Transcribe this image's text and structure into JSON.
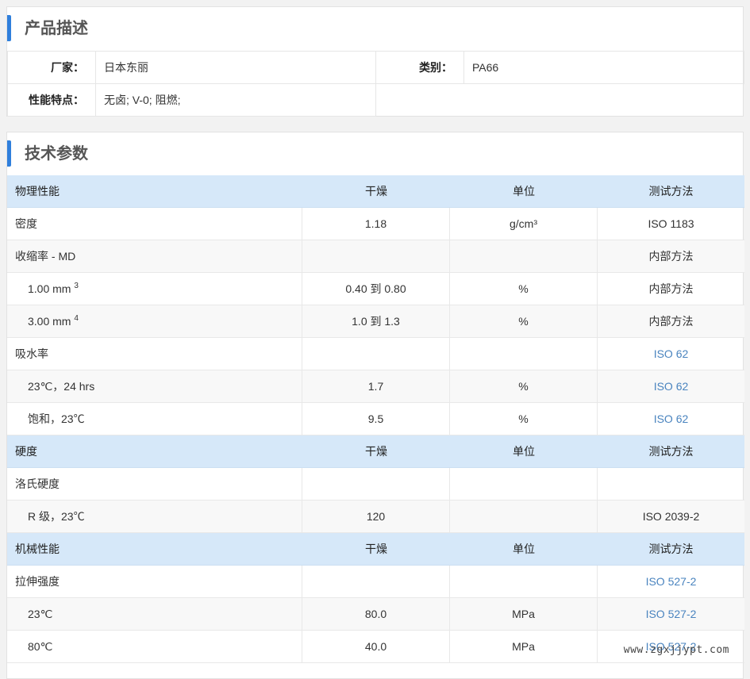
{
  "product": {
    "title": "产品描述",
    "manufacturer_label": "厂家：",
    "manufacturer_value": "日本东丽",
    "category_label": "类别：",
    "category_value": "PA66",
    "features_label": "性能特点：",
    "features_value": "无卤; V-0; 阻燃;"
  },
  "tech": {
    "title": "技术参数",
    "rows": [
      {
        "type": "header",
        "c1": "物理性能",
        "c2": "干燥",
        "c3": "单位",
        "c4": "测试方法"
      },
      {
        "type": "data",
        "c1": "密度",
        "c2": "1.18",
        "c3": "g/cm³",
        "c4": "ISO 1183"
      },
      {
        "type": "data",
        "c1": "收缩率 - MD",
        "c2": "",
        "c3": "",
        "c4": "内部方法"
      },
      {
        "type": "sub",
        "c1": "1.00 mm",
        "sup": "3",
        "c2": "0.40 到 0.80",
        "c3": "%",
        "c4": "内部方法"
      },
      {
        "type": "sub",
        "c1": "3.00 mm",
        "sup": "4",
        "c2": "1.0 到 1.3",
        "c3": "%",
        "c4": "内部方法"
      },
      {
        "type": "data",
        "c1": "吸水率",
        "c2": "",
        "c3": "",
        "c4": "ISO 62",
        "link": true
      },
      {
        "type": "sub",
        "c1": "23℃，24 hrs",
        "c2": "1.7",
        "c3": "%",
        "c4": "ISO 62",
        "link": true
      },
      {
        "type": "sub",
        "c1": "饱和，23℃",
        "c2": "9.5",
        "c3": "%",
        "c4": "ISO 62",
        "link": true
      },
      {
        "type": "header",
        "c1": "硬度",
        "c2": "干燥",
        "c3": "单位",
        "c4": "测试方法"
      },
      {
        "type": "data",
        "c1": "洛氏硬度",
        "c2": "",
        "c3": "",
        "c4": ""
      },
      {
        "type": "sub",
        "c1": "R 级，23℃",
        "c2": "120",
        "c3": "",
        "c4": "ISO 2039-2"
      },
      {
        "type": "header",
        "c1": "机械性能",
        "c2": "干燥",
        "c3": "单位",
        "c4": "测试方法"
      },
      {
        "type": "data",
        "c1": "拉伸强度",
        "c2": "",
        "c3": "",
        "c4": "ISO 527-2",
        "link": true
      },
      {
        "type": "sub",
        "c1": "23℃",
        "c2": "80.0",
        "c3": "MPa",
        "c4": "ISO 527-2",
        "link": true
      },
      {
        "type": "sub",
        "c1": "80℃",
        "c2": "40.0",
        "c3": "MPa",
        "c4": "ISO 527-2",
        "link": true
      }
    ]
  },
  "watermark": "www.zgxjjypt.com"
}
